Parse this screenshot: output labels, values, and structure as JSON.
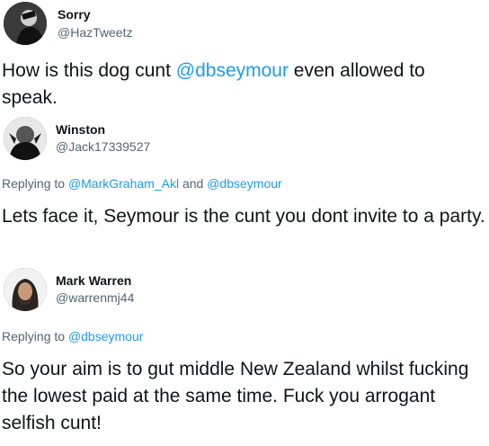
{
  "tweets": [
    {
      "name": "Sorry",
      "handle": "@HazTweetz",
      "text_before": "How is this dog cunt ",
      "mention": "@dbseymour",
      "text_after": " even allowed to speak."
    },
    {
      "name": "Winston",
      "handle": "@Jack17339527",
      "replying_prefix": "Replying to ",
      "replying_link1": "@MarkGraham_Akl",
      "replying_and": " and ",
      "replying_link2": "@dbseymour",
      "text": "Lets face it, Seymour is the cunt you dont invite to a party."
    },
    {
      "name": "Mark Warren",
      "handle": "@warrenmj44",
      "replying_prefix": "Replying to ",
      "replying_link1": "@dbseymour",
      "text": "So your aim is to gut middle New Zealand whilst fucking the lowest paid at the same time. Fuck you arrogant selfish cunt!"
    }
  ],
  "colors": {
    "link": "#1d9bf0",
    "secondary": "#536471",
    "primary": "#0f1419"
  }
}
